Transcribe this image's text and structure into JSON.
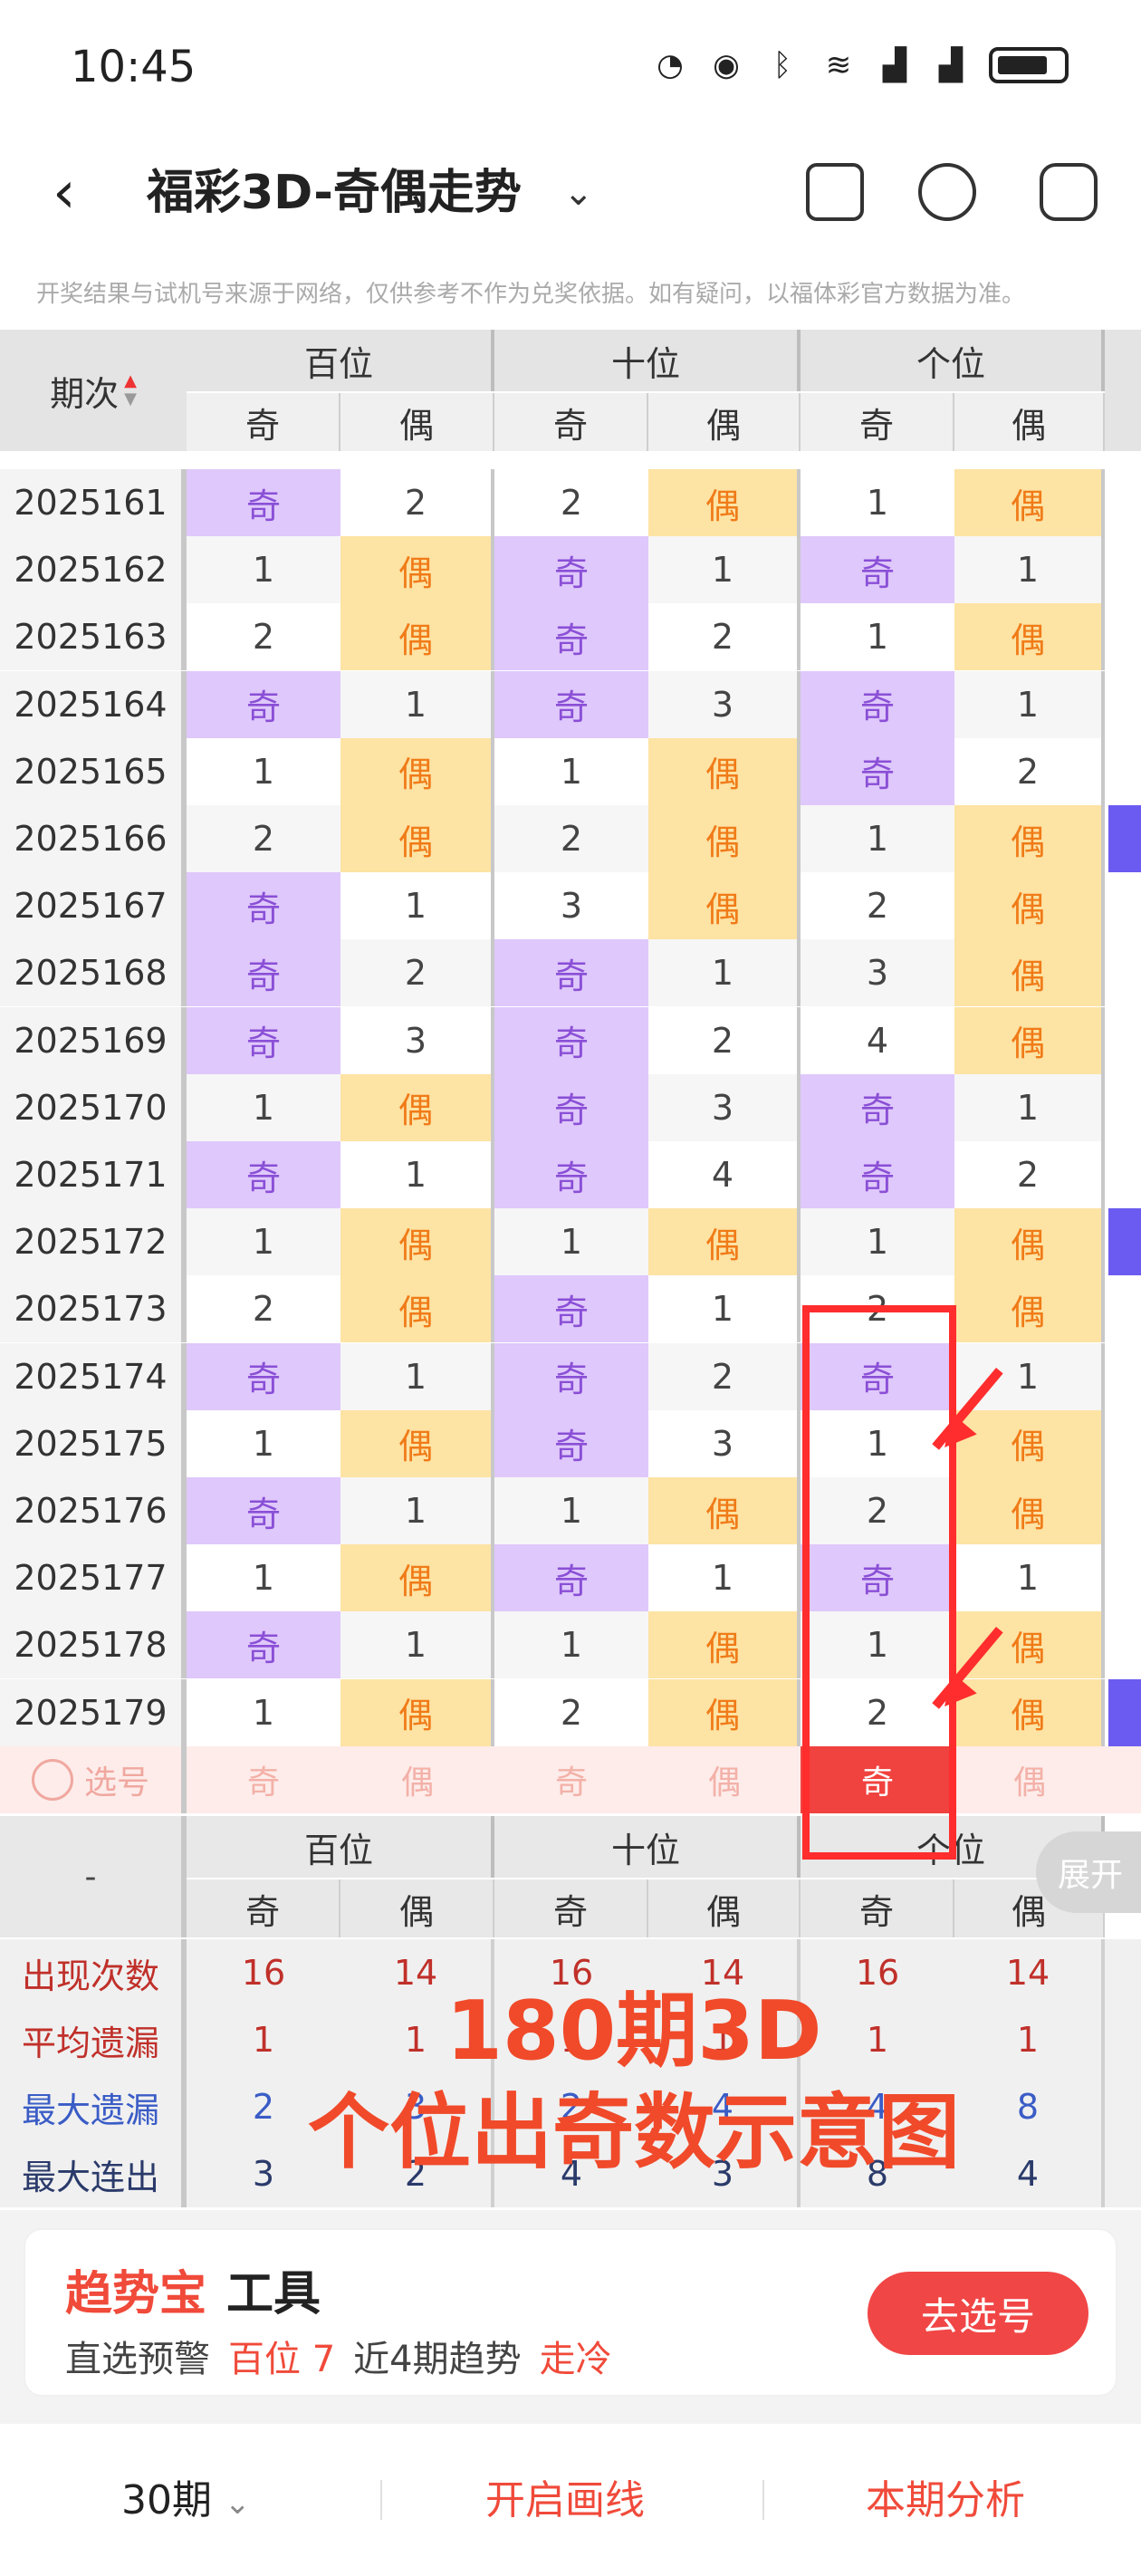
{
  "status_bar": {
    "time": "10:45",
    "icons": [
      "lock-icon",
      "eye-icon",
      "bluetooth-icon",
      "wifi-icon",
      "signal-icon",
      "signal-icon",
      "battery-icon"
    ]
  },
  "nav": {
    "title": "福彩3D-奇偶走势",
    "icons": [
      "back-icon",
      "chevron-down-icon",
      "phone-icon",
      "share-icon",
      "settings-icon"
    ]
  },
  "notice": "开奖结果与试机号来源于网络，仅供参考不作为兑奖依据。如有疑问，以福体彩官方数据为准。",
  "table": {
    "period_header": "期次",
    "groups": [
      "百位",
      "十位",
      "个位"
    ],
    "sub_headers": [
      "奇",
      "偶"
    ],
    "rows": [
      {
        "period": "2025161",
        "cells": [
          "奇",
          "2",
          "2",
          "偶",
          "1",
          "偶"
        ]
      },
      {
        "period": "2025162",
        "cells": [
          "1",
          "偶",
          "奇",
          "1",
          "奇",
          "1"
        ]
      },
      {
        "period": "2025163",
        "cells": [
          "2",
          "偶",
          "奇",
          "2",
          "1",
          "偶"
        ]
      },
      {
        "period": "2025164",
        "cells": [
          "奇",
          "1",
          "奇",
          "3",
          "奇",
          "1"
        ]
      },
      {
        "period": "2025165",
        "cells": [
          "1",
          "偶",
          "1",
          "偶",
          "奇",
          "2"
        ]
      },
      {
        "period": "2025166",
        "cells": [
          "2",
          "偶",
          "2",
          "偶",
          "1",
          "偶"
        ]
      },
      {
        "period": "2025167",
        "cells": [
          "奇",
          "1",
          "3",
          "偶",
          "2",
          "偶"
        ]
      },
      {
        "period": "2025168",
        "cells": [
          "奇",
          "2",
          "奇",
          "1",
          "3",
          "偶"
        ]
      },
      {
        "period": "2025169",
        "cells": [
          "奇",
          "3",
          "奇",
          "2",
          "4",
          "偶"
        ]
      },
      {
        "period": "2025170",
        "cells": [
          "1",
          "偶",
          "奇",
          "3",
          "奇",
          "1"
        ]
      },
      {
        "period": "2025171",
        "cells": [
          "奇",
          "1",
          "奇",
          "4",
          "奇",
          "2"
        ]
      },
      {
        "period": "2025172",
        "cells": [
          "1",
          "偶",
          "1",
          "偶",
          "1",
          "偶"
        ]
      },
      {
        "period": "2025173",
        "cells": [
          "2",
          "偶",
          "奇",
          "1",
          "2",
          "偶"
        ]
      },
      {
        "period": "2025174",
        "cells": [
          "奇",
          "1",
          "奇",
          "2",
          "奇",
          "1"
        ]
      },
      {
        "period": "2025175",
        "cells": [
          "1",
          "偶",
          "奇",
          "3",
          "1",
          "偶"
        ]
      },
      {
        "period": "2025176",
        "cells": [
          "奇",
          "1",
          "1",
          "偶",
          "2",
          "偶"
        ]
      },
      {
        "period": "2025177",
        "cells": [
          "1",
          "偶",
          "奇",
          "1",
          "奇",
          "1"
        ]
      },
      {
        "period": "2025178",
        "cells": [
          "奇",
          "1",
          "1",
          "偶",
          "1",
          "偶"
        ]
      },
      {
        "period": "2025179",
        "cells": [
          "1",
          "偶",
          "2",
          "偶",
          "2",
          "偶"
        ]
      }
    ],
    "pick_row": {
      "label": "选号",
      "cells": [
        "奇",
        "偶",
        "奇",
        "偶",
        "奇",
        "偶"
      ],
      "selected_index": 4
    }
  },
  "stats": {
    "left_header": "-",
    "groups": [
      "百位",
      "十位",
      "个位"
    ],
    "sub_headers": [
      "奇",
      "偶"
    ],
    "rows": [
      {
        "label": "出现次数",
        "color": "#c0302a",
        "values": [
          "16",
          "14",
          "16",
          "14",
          "16",
          "14"
        ]
      },
      {
        "label": "平均遗漏",
        "color": "#c0302a",
        "values": [
          "1",
          "1",
          "1",
          "1",
          "1",
          "1"
        ]
      },
      {
        "label": "最大遗漏",
        "color": "#3a5cc6",
        "values": [
          "2",
          "3",
          "2",
          "4",
          "4",
          "8"
        ]
      },
      {
        "label": "最大连出",
        "color": "#2a3a6a",
        "values": [
          "3",
          "2",
          "4",
          "3",
          "8",
          "4"
        ]
      }
    ],
    "expand_label": "展开"
  },
  "annotation": {
    "line1": "180期3D",
    "line2": "个位出奇数示意图"
  },
  "tool_card": {
    "brand": "趋势宝",
    "name": "工具",
    "pick_label": "直选预警",
    "position": "百位 7",
    "trend_label": "近4期趋势",
    "trend_value": "走冷",
    "go_button": "去选号"
  },
  "bottom_bar": {
    "periods": "30期",
    "draw_line": "开启画线",
    "analysis": "本期分析"
  },
  "colors": {
    "odd_bg": "#dfc8fb",
    "odd_text": "#8a4fd6",
    "even_bg": "#fde3a4",
    "even_text": "#f07b18",
    "accent": "#f04a3a",
    "annotation": "#ff2d2d"
  }
}
